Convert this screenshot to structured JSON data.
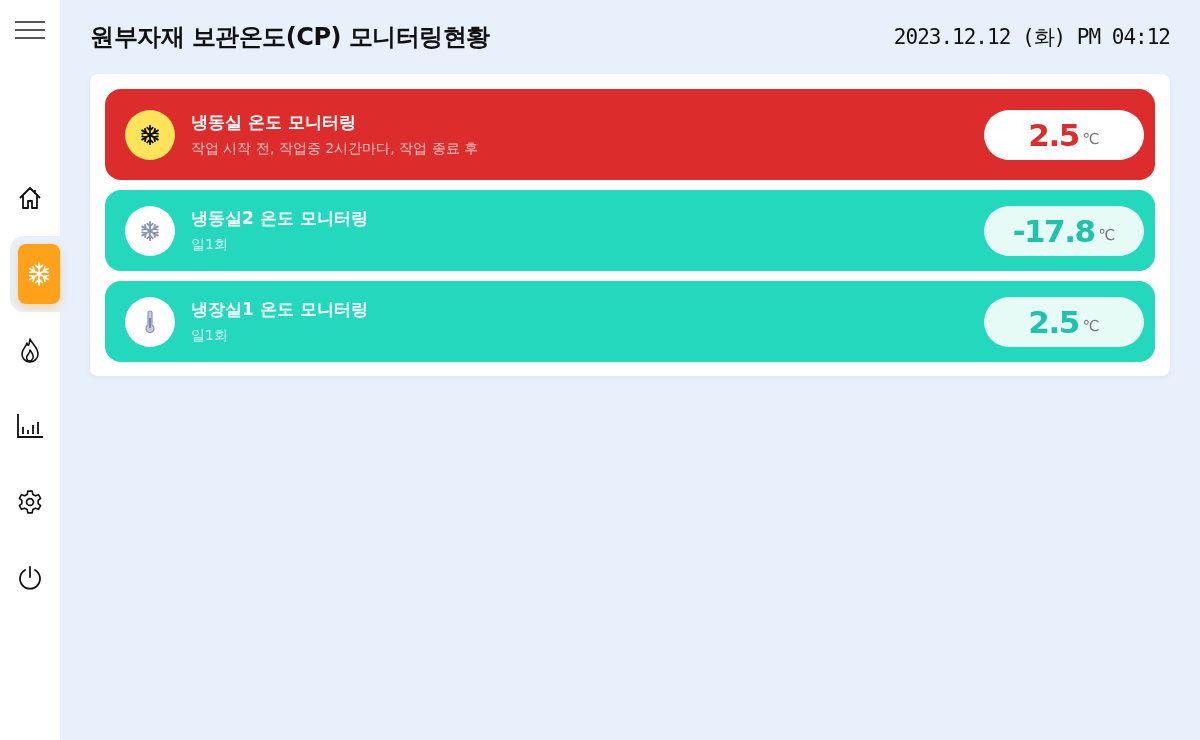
{
  "sidebar": {
    "items": [
      {
        "kind": "home",
        "selected": false
      },
      {
        "kind": "snowflake",
        "selected": true
      },
      {
        "kind": "flame",
        "selected": false
      },
      {
        "kind": "chart",
        "selected": false
      },
      {
        "kind": "gear",
        "selected": false
      },
      {
        "kind": "power",
        "selected": false
      }
    ]
  },
  "header": {
    "title": "원부자재 보관온도(CP) 모니터링현황",
    "datetime": "2023.12.12 (화) PM 04:12"
  },
  "monitors": [
    {
      "title": "냉동실 온도 모니터링",
      "schedule": "작업 시작 전, 작업중 2시간마다, 작업 종료 후",
      "kind": "snowflake",
      "alert": true,
      "value": "2.5",
      "unit": "℃"
    },
    {
      "title": "냉동실2 온도 모니터링",
      "schedule": "일1회",
      "kind": "snowflake",
      "alert": false,
      "value": "-17.8",
      "unit": "℃"
    },
    {
      "title": "냉장실1 온도 모니터링",
      "schedule": "일1회",
      "kind": "thermometer",
      "alert": false,
      "value": "2.5",
      "unit": "℃"
    }
  ]
}
